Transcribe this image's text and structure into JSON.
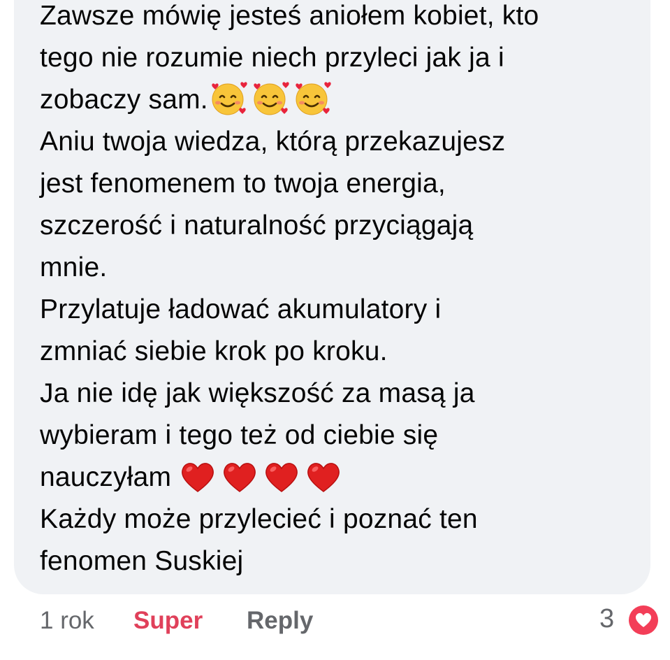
{
  "comment": {
    "lines": [
      {
        "text": "Zawsze mówię jesteś aniołem kobiet, kto",
        "emojis": []
      },
      {
        "text": "tego nie rozumie niech przyleci jak ja i",
        "emojis": []
      },
      {
        "text": "zobaczy sam.",
        "emojis": [
          "smiling-face-with-hearts",
          "smiling-face-with-hearts",
          "smiling-face-with-hearts"
        ]
      },
      {
        "text": "Aniu twoja wiedza,  którą przekazujesz",
        "emojis": []
      },
      {
        "text": "jest fenomenem to twoja energia,",
        "emojis": []
      },
      {
        "text": "szczerość i naturalność przyciągają",
        "emojis": []
      },
      {
        "text": "mnie.",
        "emojis": []
      },
      {
        "text": "Przylatuje ładować akumulatory i",
        "emojis": []
      },
      {
        "text": "zmniać siebie krok po kroku.",
        "emojis": []
      },
      {
        "text": "Ja nie idę jak większość za masą ja",
        "emojis": []
      },
      {
        "text": "wybieram i tego też od ciebie się",
        "emojis": []
      },
      {
        "text": "nauczyłam ",
        "emojis": [
          "red-heart",
          "red-heart",
          "red-heart",
          "red-heart"
        ]
      },
      {
        "text": "Każdy może przylecieć i poznać ten",
        "emojis": []
      },
      {
        "text": "fenomen Suskiej",
        "emojis": []
      }
    ]
  },
  "footer": {
    "time": "1 rok",
    "reaction_label": "Super",
    "reply_label": "Reply",
    "reaction_count": "3",
    "reaction_icon": "love-reaction-icon"
  },
  "colors": {
    "bubble": "#f0f2f5",
    "text": "#050505",
    "muted": "#65676b",
    "reaction_accent": "#e0405a",
    "love_badge": "#f33e58"
  }
}
